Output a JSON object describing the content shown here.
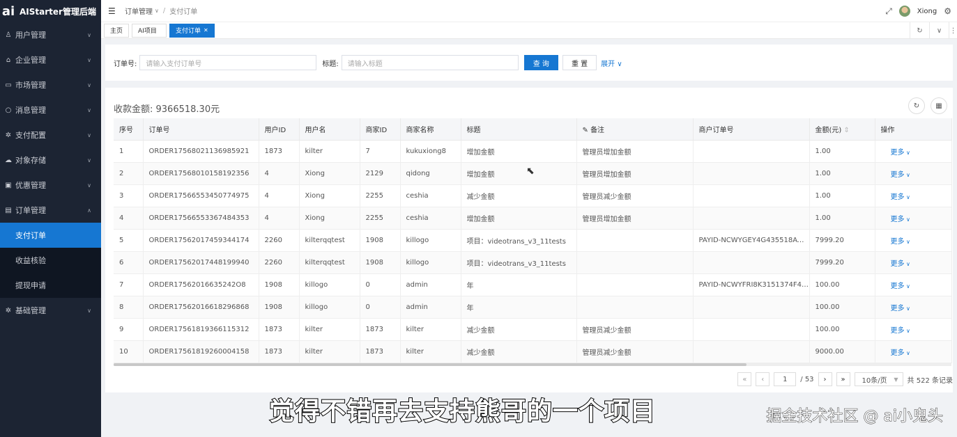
{
  "app": {
    "title": "AIStarter管理后端",
    "logo_mark": "ai"
  },
  "sidebar": {
    "items": [
      {
        "label": "用户管理",
        "icon": "user-icon",
        "glyph": "♙"
      },
      {
        "label": "企业管理",
        "icon": "bank-icon",
        "glyph": "⌂"
      },
      {
        "label": "市场管理",
        "icon": "folder-icon",
        "glyph": "▭"
      },
      {
        "label": "消息管理",
        "icon": "message-icon",
        "glyph": "○"
      },
      {
        "label": "支付配置",
        "icon": "gear-icon",
        "glyph": "✲"
      },
      {
        "label": "对象存储",
        "icon": "cloud-icon",
        "glyph": "☁"
      },
      {
        "label": "优惠管理",
        "icon": "coupon-icon",
        "glyph": "▣"
      },
      {
        "label": "订单管理",
        "icon": "order-icon",
        "glyph": "▤"
      },
      {
        "label": "基础管理",
        "icon": "gear-icon",
        "glyph": "✲"
      }
    ],
    "sub_items": [
      "支付订单",
      "收益核验",
      "提现申请"
    ]
  },
  "header": {
    "breadcrumb_parent": "订单管理",
    "breadcrumb_current": "支付订单",
    "username": "Xiong"
  },
  "tabs": [
    {
      "label": "主页"
    },
    {
      "label": "AI项目"
    },
    {
      "label": "支付订单"
    }
  ],
  "search": {
    "order_label": "订单号:",
    "order_placeholder": "请输入支付订单号",
    "title_label": "标题:",
    "title_placeholder": "请输入标题",
    "query_button": "查 询",
    "reset_button": "重 置",
    "expand_link": "展开"
  },
  "summary": {
    "total_text": "收款金额: 9366518.30元"
  },
  "table": {
    "columns": [
      "序号",
      "订单号",
      "用户ID",
      "用户名",
      "商家ID",
      "商家名称",
      "标题",
      "备注",
      "商户订单号",
      "金额(元)",
      "操作"
    ],
    "rows": [
      [
        "1",
        "ORDER17568021136985921",
        "1873",
        "kilter",
        "7",
        "kukuxiong8",
        "增加金额",
        "管理员增加金额",
        "",
        "1.00",
        "更多"
      ],
      [
        "2",
        "ORDER17568010158192356",
        "4",
        "Xiong",
        "2129",
        "qidong",
        "增加金额",
        "管理员增加金额",
        "",
        "1.00",
        "更多"
      ],
      [
        "3",
        "ORDER17566553450774975",
        "4",
        "Xiong",
        "2255",
        "ceshia",
        "减少金额",
        "管理员减少金额",
        "",
        "1.00",
        "更多"
      ],
      [
        "4",
        "ORDER17566553367484353",
        "4",
        "Xiong",
        "2255",
        "ceshia",
        "增加金额",
        "管理员增加金额",
        "",
        "1.00",
        "更多"
      ],
      [
        "5",
        "ORDER17562017459344174",
        "2260",
        "kilterqqtest",
        "1908",
        "killogo",
        "项目：videotrans_v3_11tests",
        "",
        "PAYID-NCWYGEY4G435518AW9...",
        "7999.20",
        "更多"
      ],
      [
        "6",
        "ORDER17562017448199940",
        "2260",
        "kilterqqtest",
        "1908",
        "killogo",
        "项目：videotrans_v3_11tests",
        "",
        "",
        "7999.20",
        "更多"
      ],
      [
        "7",
        "ORDER17562016635242O8",
        "1908",
        "killogo",
        "0",
        "admin",
        "年",
        "",
        "PAYID-NCWYFRI8K3151374F44...",
        "100.00",
        "更多"
      ],
      [
        "8",
        "ORDER17562016618296868",
        "1908",
        "killogo",
        "0",
        "admin",
        "年",
        "",
        "",
        "100.00",
        "更多"
      ],
      [
        "9",
        "ORDER17561819366115312",
        "1873",
        "kilter",
        "1873",
        "kilter",
        "减少金额",
        "管理员减少金额",
        "",
        "100.00",
        "更多"
      ],
      [
        "10",
        "ORDER17561819260004158",
        "1873",
        "kilter",
        "1873",
        "kilter",
        "减少金额",
        "管理员减少金额",
        "",
        "9000.00",
        "更多"
      ]
    ]
  },
  "pagination": {
    "current_page": "1",
    "total_pages": "/ 53",
    "page_size": "10条/页",
    "total": "共 522 条记录"
  },
  "overlay": {
    "subtitle": "觉得不错再去支持熊哥的一个项目",
    "watermark": "掘金技术社区 @ ai小鬼头"
  }
}
